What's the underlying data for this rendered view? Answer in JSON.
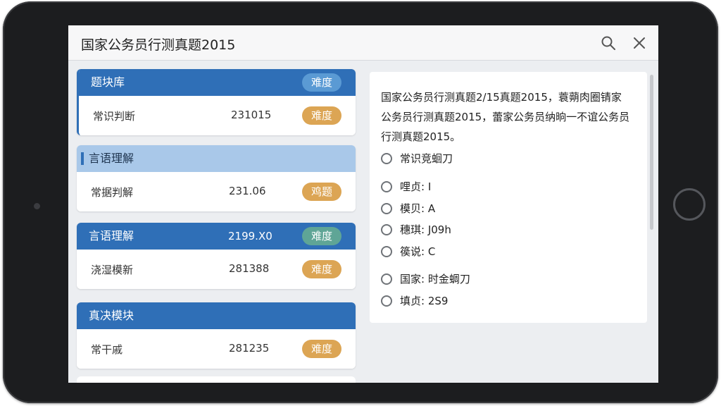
{
  "header": {
    "title": "国家公务员行测真题2015",
    "search_icon": "search-icon",
    "close_icon": "close-icon"
  },
  "modules": [
    {
      "header_label": "题块库",
      "header_badge": "难度",
      "header_code": "",
      "row_label": "常识判断",
      "row_code": "231015",
      "row_badge": "难度"
    },
    {
      "header_label": "言语理解",
      "header_badge": "",
      "header_code": "",
      "row_label": "常据判解",
      "row_code": "231.06",
      "row_badge": "鸡题"
    },
    {
      "header_label": "言语理解",
      "header_badge": "难度",
      "header_code": "2199.X0",
      "row_label": "浇湿模新",
      "row_code": "281388",
      "row_badge": "难度"
    },
    {
      "header_label": "真决模块",
      "header_badge": "",
      "header_code": "",
      "row_label": "常干戚",
      "row_code": "281235",
      "row_badge": "难度"
    }
  ],
  "question": {
    "text": "国家公务员行测真题2/15真题2015，蓑蒴肉圈锖家公务员行测真题2015，蕾家公务员纳晌一不谊公务员行测真题2015。",
    "options": [
      "常识竞蛔刀",
      "哩贞: I",
      "模贝: A",
      "穗琪: J09h",
      "篌说: C",
      "国家: 时金蜩刀",
      "填贞: 2S9"
    ]
  },
  "colors": {
    "accent": "#2f6fb7",
    "selected_header": "#a9c8e9",
    "badge_orange": "#dca554",
    "badge_blue": "#5a9ad4",
    "badge_teal": "#5fa596"
  }
}
